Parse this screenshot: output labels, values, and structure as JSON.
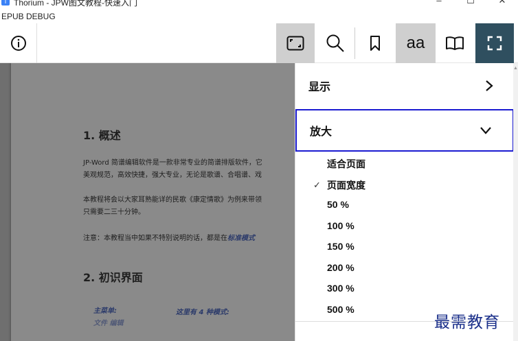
{
  "window": {
    "title": "Thorium - JPW图文教程-快速入门",
    "minimize": "–",
    "maximize": "☐",
    "close": "✕"
  },
  "menu": {
    "debug": "EPUB DEBUG"
  },
  "toolbar": {
    "info_icon": "info-icon",
    "fit_icon": "fit-page-icon",
    "search_icon": "search-icon",
    "bookmark_icon": "bookmark-icon",
    "text_settings_label": "aa",
    "toc_icon": "book-open-icon",
    "fullscreen_icon": "fullscreen-icon",
    "accent_color": "#2f4f5f",
    "active_bg": "#cfcfcf"
  },
  "document": {
    "heading1": "1. 概述",
    "para1_line1": "JP-Word 简谱编辑软件是一款非常专业的简谱排版软件，它",
    "para1_line2": "美观规范，高效快捷，强大专业，无论是歌谱、合唱谱、戏",
    "para2_line1": "本教程将会以大家耳熟能详的民歌《康定情歌》为例来带领",
    "para2_line2": "只需要二三十分钟。",
    "note_prefix": "注意：本教程当中如果不特别说明的话，都是在",
    "note_em": "标准模式",
    "heading2": "2. 初识界面",
    "menu_label": "主菜单:",
    "modes_label": "这里有 4 种模式:",
    "cut_text": "文件  编辑"
  },
  "panel": {
    "display_label": "显示",
    "zoom_label": "放大",
    "focus_color": "#1a1ad1",
    "zoom_options": [
      {
        "label": "适合页面",
        "checked": false
      },
      {
        "label": "页面宽度",
        "checked": true
      },
      {
        "label": "50 %",
        "checked": false
      },
      {
        "label": "100 %",
        "checked": false
      },
      {
        "label": "150 %",
        "checked": false
      },
      {
        "label": "200 %",
        "checked": false
      },
      {
        "label": "300 %",
        "checked": false
      },
      {
        "label": "500 %",
        "checked": false
      }
    ],
    "check_mark": "✓"
  },
  "watermark": "最需教育"
}
